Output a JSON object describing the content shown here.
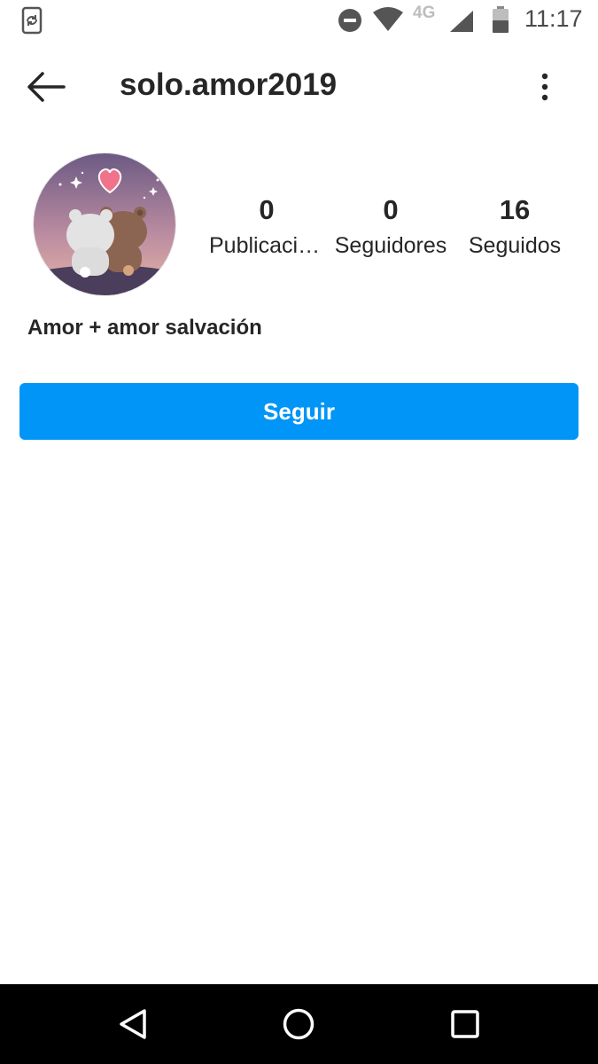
{
  "status_bar": {
    "network": "4G",
    "time": "11:17",
    "icons": [
      "screen-rotate-icon",
      "do-not-disturb-icon",
      "wifi-icon",
      "signal-icon",
      "battery-icon"
    ]
  },
  "header": {
    "username": "solo.amor2019",
    "icons": [
      "back-arrow-icon",
      "more-vertical-icon"
    ]
  },
  "profile": {
    "stats": [
      {
        "count": "0",
        "label": "Publicaciones"
      },
      {
        "count": "0",
        "label": "Seguidores"
      },
      {
        "count": "16",
        "label": "Seguidos"
      }
    ],
    "bio": "Amor + amor salvación",
    "follow_label": "Seguir"
  },
  "nav_bar": {
    "icons": [
      "nav-back-icon",
      "nav-home-icon",
      "nav-recents-icon"
    ]
  },
  "colors": {
    "accent": "#0095f6",
    "text": "#262626",
    "nav_background": "#000000"
  }
}
